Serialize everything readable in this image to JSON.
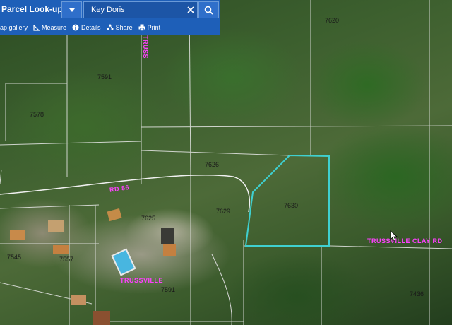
{
  "panel": {
    "title": "Parcel Look-up",
    "search_value": "Key Doris",
    "toolbar": [
      {
        "label": "ap gallery",
        "icon": "map-gallery-icon"
      },
      {
        "label": "Measure",
        "icon": "measure-icon"
      },
      {
        "label": "Details",
        "icon": "info-icon"
      },
      {
        "label": "Share",
        "icon": "share-icon"
      },
      {
        "label": "Print",
        "icon": "print-icon"
      }
    ]
  },
  "map": {
    "parcels": {
      "p7620": "7620",
      "p7591": "7591",
      "p7578": "7578",
      "p7626": "7626",
      "p7625": "7625",
      "p7629": "7629",
      "p7630": "7630",
      "p7545": "7545",
      "p7557": "7557",
      "p7436": "7436",
      "p7591b": "7591"
    },
    "roads": {
      "trussville_east": "TRUSSVILLE CLAY RD",
      "trussville_town": "TRUSSVILLE",
      "truss_top": "TRUSS",
      "road_short": "RD 86"
    },
    "highlight_color": "#3fd0d0",
    "road_label_color": "#ff40ff"
  }
}
